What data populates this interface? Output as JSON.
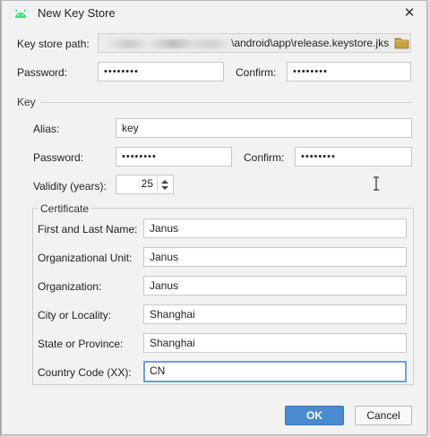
{
  "window": {
    "title": "New Key Store",
    "close_glyph": "✕",
    "icon": "android-icon",
    "accent": "#4a8bd0"
  },
  "keystore": {
    "path_label": "Key store path:",
    "path_visible": "\\android\\app\\release.keystore.jks",
    "password_label": "Password:",
    "password_value": "••••••••",
    "confirm_label": "Confirm:",
    "confirm_value": "••••••••"
  },
  "key": {
    "section_label": "Key",
    "alias_label": "Alias:",
    "alias_value": "key",
    "password_label": "Password:",
    "password_value": "••••••••",
    "confirm_label": "Confirm:",
    "confirm_value": "••••••••",
    "validity_label": "Validity (years):",
    "validity_value": "25"
  },
  "certificate": {
    "section_label": "Certificate",
    "name_label": "First and Last Name:",
    "name_value": "Janus",
    "unit_label": "Organizational Unit:",
    "unit_value": "Janus",
    "org_label": "Organization:",
    "org_value": "Janus",
    "city_label": "City or Locality:",
    "city_value": "Shanghai",
    "state_label": "State or Province:",
    "state_value": "Shanghai",
    "country_label": "Country Code (XX):",
    "country_value": "CN"
  },
  "buttons": {
    "ok_label": "OK",
    "cancel_label": "Cancel"
  }
}
